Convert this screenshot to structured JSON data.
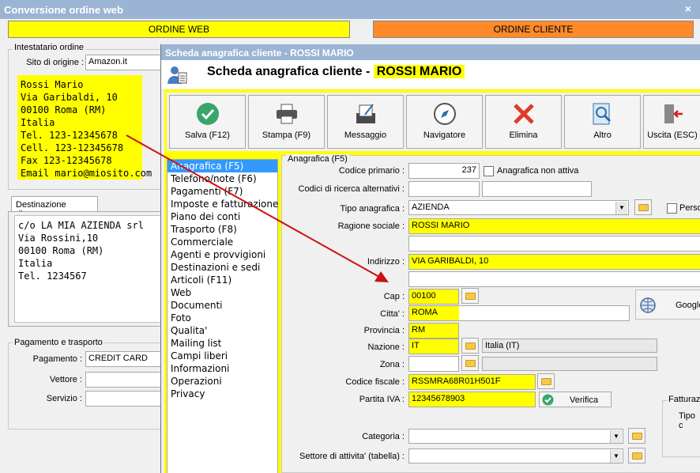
{
  "back_window": {
    "title": "Conversione ordine web",
    "close_symbol": "×",
    "btn_ordine_web": "ORDINE WEB",
    "btn_ordine_cliente": "ORDINE CLIENTE",
    "intestatario": {
      "group_label": "Intestatario ordine",
      "sito_label": "Sito di origine :",
      "sito_value": "Amazon.it",
      "lines": [
        "Rossi Mario",
        "Via Garibaldi, 10",
        "00100 Roma (RM)",
        "Italia",
        "Tel. 123-12345678",
        "Cell. 123-12345678",
        "Fax 123-12345678",
        "Email mario@miosito.com"
      ]
    },
    "destinazione": {
      "tab_label": "Destinazione diversa",
      "lines": [
        "c/o LA MIA AZIENDA srl",
        "Via Rossini,10",
        "00100 Roma (RM)",
        "Italia",
        "Tel. 1234567"
      ]
    },
    "pagamento": {
      "group_label": "Pagamento e trasporto",
      "pagamento_label": "Pagamento :",
      "pagamento_value": "CREDIT CARD",
      "vettore_label": "Vettore :",
      "vettore_value": "",
      "servizio_label": "Servizio :",
      "servizio_value": ""
    }
  },
  "front_window": {
    "title": "Scheda anagrafica cliente - ROSSI MARIO",
    "header_prefix": "Scheda anagrafica cliente - ",
    "header_name": "ROSSI MARIO",
    "toolbar": [
      {
        "label": "Salva (F12)",
        "icon": "check-icon"
      },
      {
        "label": "Stampa (F9)",
        "icon": "printer-icon"
      },
      {
        "label": "Messaggio",
        "icon": "message-icon"
      },
      {
        "label": "Navigatore",
        "icon": "compass-icon"
      },
      {
        "label": "Elimina",
        "icon": "delete-icon"
      },
      {
        "label": "Altro",
        "icon": "search-doc-icon"
      },
      {
        "label": "Uscita (ESC)",
        "icon": "exit-icon"
      }
    ],
    "nav_items": [
      "Anagrafica (F5)",
      "Telefono/note (F6)",
      "Pagamenti (F7)",
      "Imposte e fatturazione",
      "Piano dei conti",
      "Trasporto (F8)",
      "Commerciale",
      "Agenti e provvigioni",
      "Destinazioni e sedi",
      "Articoli (F11)",
      "Web",
      "Documenti",
      "Foto",
      "Qualita'",
      "Mailing list",
      "Campi liberi",
      "Informazioni",
      "Operazioni",
      "Privacy"
    ],
    "selected_nav": "Anagrafica (F5)",
    "form": {
      "group_label": "Anagrafica (F5)",
      "codice_primario_label": "Codice primario :",
      "codice_primario_value": "237",
      "non_attiva_label": "Anagrafica non attiva",
      "codici_alt_label": "Codici di ricerca alternativi :",
      "tipo_label": "Tipo anagrafica :",
      "tipo_value": "AZIENDA",
      "persona_label": "Perso",
      "ragione_label": "Ragione sociale :",
      "ragione_value": "ROSSI MARIO",
      "indirizzo_label": "Indirizzo :",
      "indirizzo_value": "VIA GARIBALDI, 10",
      "cap_label": "Cap :",
      "cap_value": "00100",
      "citta_label": "Citta' :",
      "citta_value": "ROMA",
      "provincia_label": "Provincia :",
      "provincia_value": "RM",
      "nazione_label": "Nazione :",
      "nazione_value": "IT",
      "nazione_desc": "Italia (IT)",
      "zona_label": "Zona :",
      "codfisc_label": "Codice fiscale :",
      "codfisc_value": "RSSMRA68R01H501F",
      "piva_label": "Partita IVA :",
      "piva_value": "12345678903",
      "verifica_label": "Verifica",
      "google_label": "Google",
      "fattura_label": "Fatturaz",
      "tipo_c_label": "Tipo c",
      "categoria_label": "Categoria :",
      "settore_label": "Settore di attivita' (tabella) :"
    }
  },
  "colors": {
    "highlight": "#ffff00",
    "orange": "#ff8a2a",
    "titlebar": "#9bb4d4",
    "arrow": "#cc1111",
    "selection": "#3399ff"
  }
}
